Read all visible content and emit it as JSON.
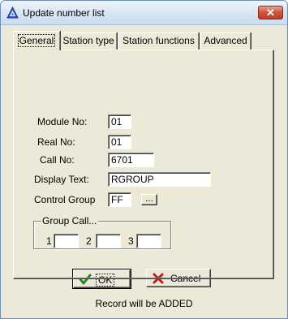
{
  "window": {
    "title": "Update number list",
    "close_symbol": "✕",
    "icon": "app-triangle-icon"
  },
  "tabs": [
    {
      "label": "General",
      "active": true
    },
    {
      "label": "Station type",
      "active": false
    },
    {
      "label": "Station functions",
      "active": false
    },
    {
      "label": "Advanced",
      "active": false
    }
  ],
  "general": {
    "module_no": {
      "label": "Module No:",
      "value": "01"
    },
    "real_no": {
      "label": "Real No:",
      "value": "01"
    },
    "call_no": {
      "label": "Call No:",
      "value": "6701"
    },
    "display_text": {
      "label": "Display Text:",
      "value": "RGROUP"
    },
    "control_group": {
      "label": "Control Group",
      "value": "FF",
      "browse_label": "..."
    },
    "group_call": {
      "legend": "Group Call...",
      "items": [
        {
          "label": "1",
          "value": ""
        },
        {
          "label": "2",
          "value": ""
        },
        {
          "label": "3",
          "value": ""
        }
      ]
    }
  },
  "buttons": {
    "ok": {
      "label": "OK",
      "icon": "check-icon"
    },
    "cancel": {
      "label": "Cancel",
      "icon": "x-icon"
    }
  },
  "status_text": "Record will be ADDED",
  "colors": {
    "dialog_bg": "#ece9d8",
    "check_green": "#1e8c1e",
    "cancel_red": "#c0201a"
  }
}
